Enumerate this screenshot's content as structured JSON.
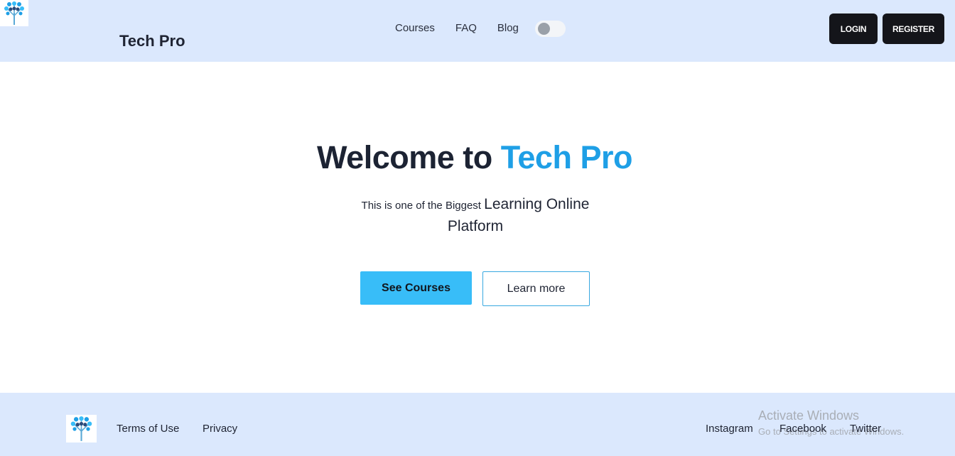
{
  "header": {
    "brand": "Tech Pro",
    "logo_icon": "tree-network-logo-icon",
    "nav": [
      {
        "label": "Courses"
      },
      {
        "label": "FAQ"
      },
      {
        "label": "Blog"
      }
    ],
    "theme_toggle": {
      "state": "off"
    },
    "login_label": "LOGIN",
    "register_label": "REGISTER"
  },
  "hero": {
    "title_prefix": "Welcome to ",
    "title_accent": "Tech Pro",
    "subtitle_small": "This is one of the Biggest ",
    "subtitle_big": "Learning Online Platform",
    "primary_button": "See Courses",
    "secondary_button": "Learn more"
  },
  "footer": {
    "links_left": [
      "Terms of Use",
      "Privacy"
    ],
    "links_right": [
      "Instagram",
      "Facebook",
      "Twitter"
    ]
  },
  "watermark": {
    "title": "Activate Windows",
    "subtitle": "Go to Settings to activate Windows."
  },
  "colors": {
    "header_bg": "#dbe8fd",
    "accent": "#1e9fe6",
    "primary_button": "#38bdf8",
    "dark_button": "#14151a"
  }
}
